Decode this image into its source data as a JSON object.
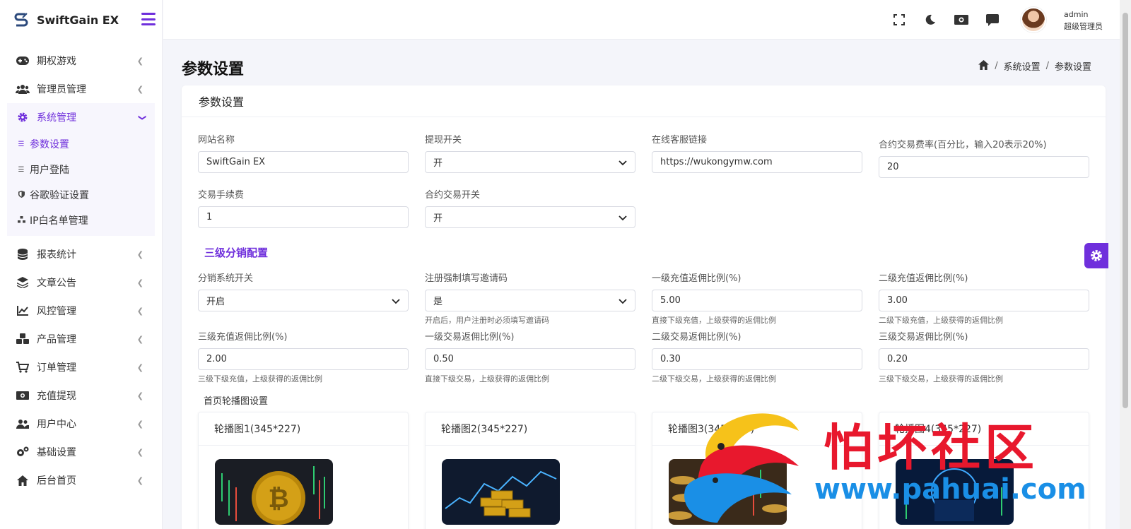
{
  "brand": {
    "name": "SwiftGain EX"
  },
  "sidebar": {
    "items": [
      {
        "label": "期权游戏",
        "icon": "gamepad-icon"
      },
      {
        "label": "管理员管理",
        "icon": "users-icon"
      },
      {
        "label": "系统管理",
        "icon": "gear-icon",
        "active": true,
        "children": [
          {
            "label": "参数设置",
            "icon": "list-icon",
            "active": true
          },
          {
            "label": "用户登陆",
            "icon": "list-icon"
          },
          {
            "label": "谷歌验证设置",
            "icon": "shield-icon"
          },
          {
            "label": "IP白名单管理",
            "icon": "network-icon"
          }
        ]
      },
      {
        "label": "报表统计",
        "icon": "database-icon"
      },
      {
        "label": "文章公告",
        "icon": "layers-icon"
      },
      {
        "label": "风控管理",
        "icon": "line-chart-icon"
      },
      {
        "label": "产品管理",
        "icon": "cubes-icon"
      },
      {
        "label": "订单管理",
        "icon": "cart-icon"
      },
      {
        "label": "充值提现",
        "icon": "money-icon"
      },
      {
        "label": "用户中心",
        "icon": "users-icon"
      },
      {
        "label": "基础设置",
        "icon": "gears-icon"
      },
      {
        "label": "后台首页",
        "icon": "home-icon"
      }
    ]
  },
  "topbar": {
    "icons": [
      "fullscreen-icon",
      "moon-icon",
      "money-icon",
      "comment-icon"
    ],
    "user": {
      "name": "admin",
      "role": "超级管理员"
    }
  },
  "page": {
    "title": "参数设置",
    "breadcrumb": [
      "系统设置",
      "参数设置"
    ]
  },
  "card": {
    "title": "参数设置",
    "fields": {
      "site_name": {
        "label": "网站名称",
        "value": "SwiftGain EX"
      },
      "withdraw_switch": {
        "label": "提现开关",
        "value": "开"
      },
      "service_link": {
        "label": "在线客服链接",
        "value": "https://wukongymw.com"
      },
      "contract_fee": {
        "label": "合约交易费率(百分比，输入20表示20%)",
        "value": "20"
      },
      "trade_fee": {
        "label": "交易手续费",
        "value": "1"
      },
      "contract_switch": {
        "label": "合约交易开关",
        "value": "开"
      }
    },
    "section_title": "三级分销配置",
    "dist": {
      "dist_switch": {
        "label": "分销系统开关",
        "value": "开启"
      },
      "force_invite": {
        "label": "注册强制填写邀请码",
        "value": "是",
        "help": "开启后，用户注册时必须填写邀请码"
      },
      "l1_recharge": {
        "label": "一级充值返佣比例(%)",
        "value": "5.00",
        "help": "直接下级充值，上级获得的返佣比例"
      },
      "l2_recharge": {
        "label": "二级充值返佣比例(%)",
        "value": "3.00",
        "help": "二级下级充值，上级获得的返佣比例"
      },
      "l3_recharge": {
        "label": "三级充值返佣比例(%)",
        "value": "2.00",
        "help": "三级下级充值，上级获得的返佣比例"
      },
      "l1_trade": {
        "label": "一级交易返佣比例(%)",
        "value": "0.50",
        "help": "直接下级交易，上级获得的返佣比例"
      },
      "l2_trade": {
        "label": "二级交易返佣比例(%)",
        "value": "0.30",
        "help": "二级下级交易，上级获得的返佣比例"
      },
      "l3_trade": {
        "label": "三级交易返佣比例(%)",
        "value": "0.20",
        "help": "三级下级交易，上级获得的返佣比例"
      }
    },
    "banner_section_title": "首页轮播图设置",
    "banners": [
      {
        "title": "轮播图1(345*227)"
      },
      {
        "title": "轮播图2(345*227)"
      },
      {
        "title": "轮播图3(345*227)"
      },
      {
        "title": "轮播图4(345*227)"
      }
    ]
  },
  "watermark": {
    "text": "怕坏社区",
    "url": "www.pahuai.com"
  },
  "colors": {
    "accent": "#6f2fdc",
    "watermark_red": "#e8182d",
    "watermark_blue": "#1a8fe6"
  }
}
